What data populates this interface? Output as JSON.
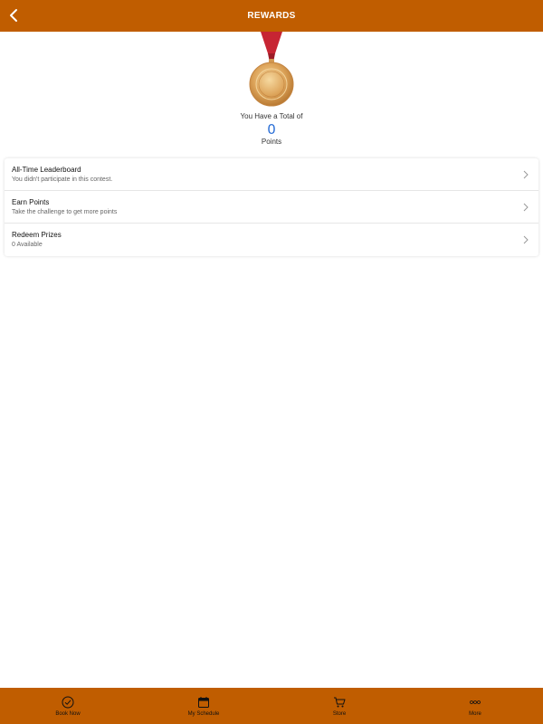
{
  "header": {
    "title": "REWARDS"
  },
  "summary": {
    "total_label": "You Have a Total of",
    "points_value": "0",
    "points_label": "Points"
  },
  "menu": [
    {
      "title": "All-Time Leaderboard",
      "subtitle": "You didn't participate in this contest."
    },
    {
      "title": "Earn Points",
      "subtitle": "Take the challenge to get more points"
    },
    {
      "title": "Redeem Prizes",
      "subtitle": "0 Available"
    }
  ],
  "tabs": [
    {
      "label": "Book Now",
      "icon": "check-circle-icon"
    },
    {
      "label": "My Schedule",
      "icon": "calendar-icon"
    },
    {
      "label": "Store",
      "icon": "cart-icon"
    },
    {
      "label": "More",
      "icon": "more-icon"
    }
  ],
  "colors": {
    "brand": "#c05d00",
    "points": "#2b6fd6"
  }
}
